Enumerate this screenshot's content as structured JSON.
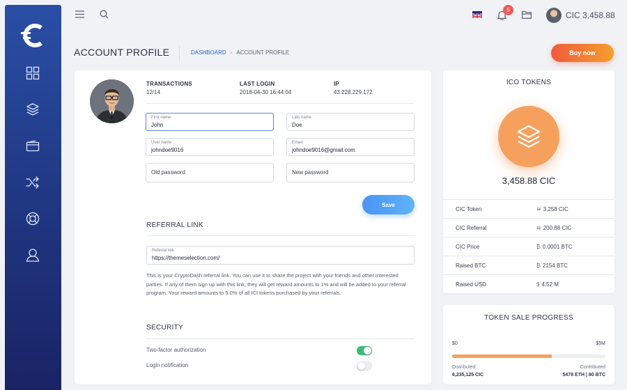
{
  "topbar": {
    "balance": "CIC 3,458.88",
    "notification_count": "5"
  },
  "header": {
    "title": "ACCOUNT PROFILE",
    "breadcrumb_home": "DASHBOARD",
    "breadcrumb_separator": "-",
    "breadcrumb_current": "ACCOUNT PROFILE",
    "buy_label": "Buy now"
  },
  "profile": {
    "stats": [
      {
        "label": "TRANSACTIONS",
        "value": "12/14"
      },
      {
        "label": "LAST LOGIN",
        "value": "2018-04-30 16:44:04"
      },
      {
        "label": "IP",
        "value": "43.228.229.172"
      }
    ],
    "fields": {
      "first_name": {
        "label": "First name",
        "value": "John"
      },
      "last_name": {
        "label": "Lats name",
        "value": "Doe"
      },
      "username": {
        "label": "User name",
        "value": "johndoe9016"
      },
      "email": {
        "label": "Email",
        "value": "johndoe9016@gmail.com"
      },
      "old_password": {
        "placeholder": "Old password"
      },
      "new_password": {
        "placeholder": "New password"
      }
    },
    "save_label": "Save",
    "referral": {
      "title": "REFERRAL LINK",
      "label": "Referral link",
      "value": "https://themeselection.com/",
      "description": "This is your CryptoDash referral link. You can use it to share the project with your friends and other interested parties. If any of them sign up with this link, they will get reward amounts to 1% and will be added to your referral program. Your reward amounts to 5.0% of all ICI tokens purchased by your referrals."
    },
    "security": {
      "title": "SECURITY",
      "two_factor_label": "Two-factor authorization",
      "two_factor_on": true,
      "login_notification_label": "Login notification",
      "login_notification_on": false
    }
  },
  "ico": {
    "title": "ICO TOKENS",
    "amount": "3,458.88 CIC",
    "rows": [
      {
        "label": "CIC Token",
        "value": "3,258 CIC",
        "icon": "layers-icon"
      },
      {
        "label": "CIC Referral",
        "value": "200.88 CIC",
        "icon": "layers-icon"
      },
      {
        "label": "CIC Price",
        "value": "0.0001 BTC",
        "icon": "bitcoin-icon"
      },
      {
        "label": "Raised BTC",
        "value": "2154 BTC",
        "icon": "bitcoin-icon"
      },
      {
        "label": "Raised USD",
        "value": "4.52 M",
        "icon": "dollar-icon"
      }
    ]
  },
  "progress": {
    "title": "TOKEN SALE PROGRESS",
    "min_label": "$0",
    "max_label": "$5M",
    "fill_percent": 65,
    "distributed_label": "Distributed",
    "distributed_value": "6,235,125 CIC",
    "contributed_label": "Contributed",
    "contributed_value": "5478 ETH | 80 BTC"
  },
  "colors": {
    "sidebar_top": "#2a4fa6",
    "sidebar_bottom": "#1a2365",
    "accent_orange": "#f5a15d",
    "accent_blue": "#4a93f3",
    "toggle_on": "#3bbd77"
  }
}
